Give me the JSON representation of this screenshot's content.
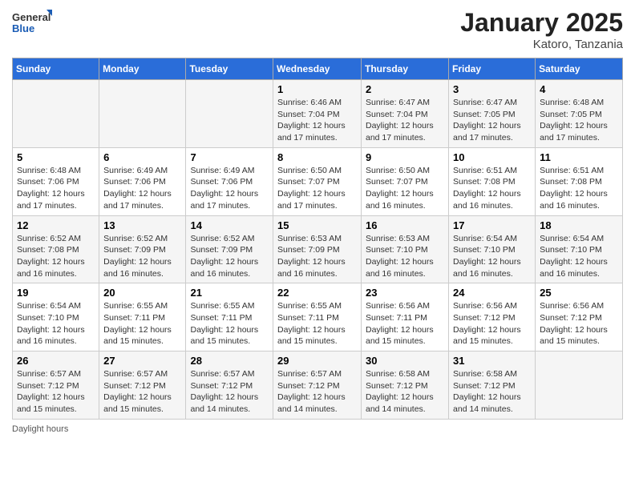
{
  "logo": {
    "general": "General",
    "blue": "Blue"
  },
  "title": {
    "month_year": "January 2025",
    "location": "Katoro, Tanzania"
  },
  "weekdays": [
    "Sunday",
    "Monday",
    "Tuesday",
    "Wednesday",
    "Thursday",
    "Friday",
    "Saturday"
  ],
  "weeks": [
    [
      {
        "day": "",
        "sunrise": "",
        "sunset": "",
        "daylight": ""
      },
      {
        "day": "",
        "sunrise": "",
        "sunset": "",
        "daylight": ""
      },
      {
        "day": "",
        "sunrise": "",
        "sunset": "",
        "daylight": ""
      },
      {
        "day": "1",
        "sunrise": "Sunrise: 6:46 AM",
        "sunset": "Sunset: 7:04 PM",
        "daylight": "Daylight: 12 hours and 17 minutes."
      },
      {
        "day": "2",
        "sunrise": "Sunrise: 6:47 AM",
        "sunset": "Sunset: 7:04 PM",
        "daylight": "Daylight: 12 hours and 17 minutes."
      },
      {
        "day": "3",
        "sunrise": "Sunrise: 6:47 AM",
        "sunset": "Sunset: 7:05 PM",
        "daylight": "Daylight: 12 hours and 17 minutes."
      },
      {
        "day": "4",
        "sunrise": "Sunrise: 6:48 AM",
        "sunset": "Sunset: 7:05 PM",
        "daylight": "Daylight: 12 hours and 17 minutes."
      }
    ],
    [
      {
        "day": "5",
        "sunrise": "Sunrise: 6:48 AM",
        "sunset": "Sunset: 7:06 PM",
        "daylight": "Daylight: 12 hours and 17 minutes."
      },
      {
        "day": "6",
        "sunrise": "Sunrise: 6:49 AM",
        "sunset": "Sunset: 7:06 PM",
        "daylight": "Daylight: 12 hours and 17 minutes."
      },
      {
        "day": "7",
        "sunrise": "Sunrise: 6:49 AM",
        "sunset": "Sunset: 7:06 PM",
        "daylight": "Daylight: 12 hours and 17 minutes."
      },
      {
        "day": "8",
        "sunrise": "Sunrise: 6:50 AM",
        "sunset": "Sunset: 7:07 PM",
        "daylight": "Daylight: 12 hours and 17 minutes."
      },
      {
        "day": "9",
        "sunrise": "Sunrise: 6:50 AM",
        "sunset": "Sunset: 7:07 PM",
        "daylight": "Daylight: 12 hours and 16 minutes."
      },
      {
        "day": "10",
        "sunrise": "Sunrise: 6:51 AM",
        "sunset": "Sunset: 7:08 PM",
        "daylight": "Daylight: 12 hours and 16 minutes."
      },
      {
        "day": "11",
        "sunrise": "Sunrise: 6:51 AM",
        "sunset": "Sunset: 7:08 PM",
        "daylight": "Daylight: 12 hours and 16 minutes."
      }
    ],
    [
      {
        "day": "12",
        "sunrise": "Sunrise: 6:52 AM",
        "sunset": "Sunset: 7:08 PM",
        "daylight": "Daylight: 12 hours and 16 minutes."
      },
      {
        "day": "13",
        "sunrise": "Sunrise: 6:52 AM",
        "sunset": "Sunset: 7:09 PM",
        "daylight": "Daylight: 12 hours and 16 minutes."
      },
      {
        "day": "14",
        "sunrise": "Sunrise: 6:52 AM",
        "sunset": "Sunset: 7:09 PM",
        "daylight": "Daylight: 12 hours and 16 minutes."
      },
      {
        "day": "15",
        "sunrise": "Sunrise: 6:53 AM",
        "sunset": "Sunset: 7:09 PM",
        "daylight": "Daylight: 12 hours and 16 minutes."
      },
      {
        "day": "16",
        "sunrise": "Sunrise: 6:53 AM",
        "sunset": "Sunset: 7:10 PM",
        "daylight": "Daylight: 12 hours and 16 minutes."
      },
      {
        "day": "17",
        "sunrise": "Sunrise: 6:54 AM",
        "sunset": "Sunset: 7:10 PM",
        "daylight": "Daylight: 12 hours and 16 minutes."
      },
      {
        "day": "18",
        "sunrise": "Sunrise: 6:54 AM",
        "sunset": "Sunset: 7:10 PM",
        "daylight": "Daylight: 12 hours and 16 minutes."
      }
    ],
    [
      {
        "day": "19",
        "sunrise": "Sunrise: 6:54 AM",
        "sunset": "Sunset: 7:10 PM",
        "daylight": "Daylight: 12 hours and 16 minutes."
      },
      {
        "day": "20",
        "sunrise": "Sunrise: 6:55 AM",
        "sunset": "Sunset: 7:11 PM",
        "daylight": "Daylight: 12 hours and 15 minutes."
      },
      {
        "day": "21",
        "sunrise": "Sunrise: 6:55 AM",
        "sunset": "Sunset: 7:11 PM",
        "daylight": "Daylight: 12 hours and 15 minutes."
      },
      {
        "day": "22",
        "sunrise": "Sunrise: 6:55 AM",
        "sunset": "Sunset: 7:11 PM",
        "daylight": "Daylight: 12 hours and 15 minutes."
      },
      {
        "day": "23",
        "sunrise": "Sunrise: 6:56 AM",
        "sunset": "Sunset: 7:11 PM",
        "daylight": "Daylight: 12 hours and 15 minutes."
      },
      {
        "day": "24",
        "sunrise": "Sunrise: 6:56 AM",
        "sunset": "Sunset: 7:12 PM",
        "daylight": "Daylight: 12 hours and 15 minutes."
      },
      {
        "day": "25",
        "sunrise": "Sunrise: 6:56 AM",
        "sunset": "Sunset: 7:12 PM",
        "daylight": "Daylight: 12 hours and 15 minutes."
      }
    ],
    [
      {
        "day": "26",
        "sunrise": "Sunrise: 6:57 AM",
        "sunset": "Sunset: 7:12 PM",
        "daylight": "Daylight: 12 hours and 15 minutes."
      },
      {
        "day": "27",
        "sunrise": "Sunrise: 6:57 AM",
        "sunset": "Sunset: 7:12 PM",
        "daylight": "Daylight: 12 hours and 15 minutes."
      },
      {
        "day": "28",
        "sunrise": "Sunrise: 6:57 AM",
        "sunset": "Sunset: 7:12 PM",
        "daylight": "Daylight: 12 hours and 14 minutes."
      },
      {
        "day": "29",
        "sunrise": "Sunrise: 6:57 AM",
        "sunset": "Sunset: 7:12 PM",
        "daylight": "Daylight: 12 hours and 14 minutes."
      },
      {
        "day": "30",
        "sunrise": "Sunrise: 6:58 AM",
        "sunset": "Sunset: 7:12 PM",
        "daylight": "Daylight: 12 hours and 14 minutes."
      },
      {
        "day": "31",
        "sunrise": "Sunrise: 6:58 AM",
        "sunset": "Sunset: 7:12 PM",
        "daylight": "Daylight: 12 hours and 14 minutes."
      },
      {
        "day": "",
        "sunrise": "",
        "sunset": "",
        "daylight": ""
      }
    ]
  ],
  "footer": {
    "daylight_label": "Daylight hours"
  }
}
